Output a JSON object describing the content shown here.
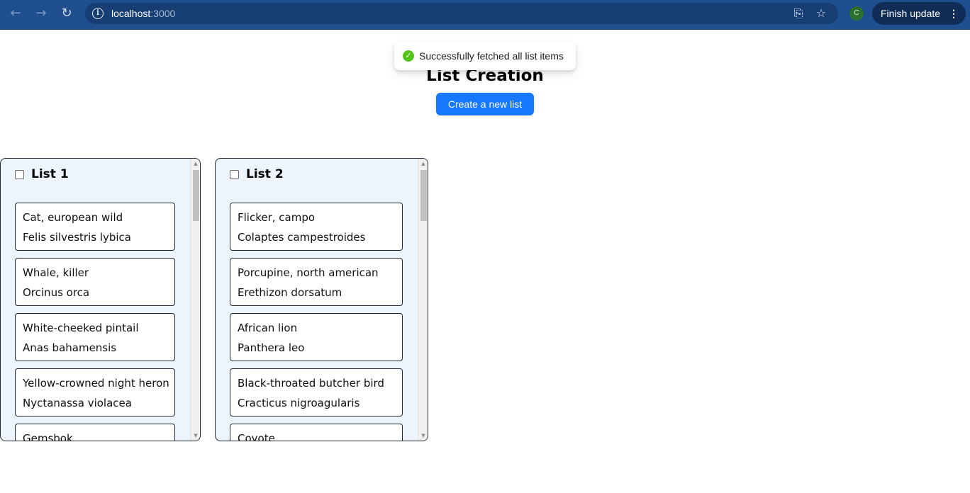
{
  "browser": {
    "url_host": "localhost",
    "url_port": ":3000",
    "profile_initial": "C",
    "update_label": "Finish update"
  },
  "toast": {
    "message": "Successfully fetched all list items"
  },
  "page": {
    "title": "List Creation",
    "create_button_label": "Create a new list"
  },
  "lists": [
    {
      "title": "List 1",
      "items": [
        {
          "common": "Cat, european wild",
          "scientific": "Felis silvestris lybica"
        },
        {
          "common": "Whale, killer",
          "scientific": "Orcinus orca"
        },
        {
          "common": "White-cheeked pintail",
          "scientific": "Anas bahamensis"
        },
        {
          "common": "Yellow-crowned night heron",
          "scientific": "Nyctanassa violacea"
        },
        {
          "common": "Gemsbok",
          "scientific": ""
        }
      ]
    },
    {
      "title": "List 2",
      "items": [
        {
          "common": "Flicker, campo",
          "scientific": "Colaptes campestroides"
        },
        {
          "common": "Porcupine, north american",
          "scientific": "Erethizon dorsatum"
        },
        {
          "common": "African lion",
          "scientific": "Panthera leo"
        },
        {
          "common": "Black-throated butcher bird",
          "scientific": "Cracticus nigroagularis"
        },
        {
          "common": "Coyote",
          "scientific": ""
        }
      ]
    }
  ],
  "colors": {
    "primary": "#1677ff",
    "list_bg": "#edf4fc",
    "success": "#52c41a",
    "chrome": "#1f4f8e"
  }
}
